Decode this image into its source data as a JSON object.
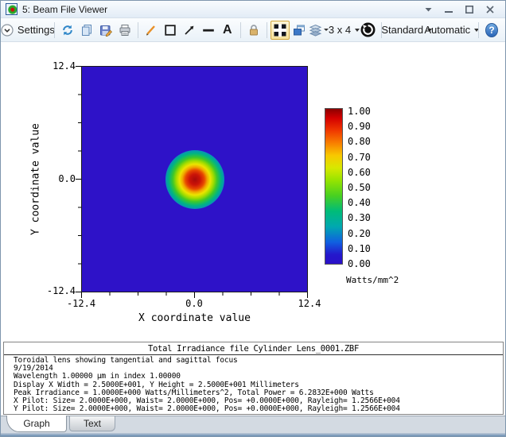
{
  "titlebar": {
    "title": "5: Beam File Viewer"
  },
  "toolbar": {
    "settings_label": "Settings",
    "text_tool_label": "A",
    "grid_label": "3 x 4",
    "standard_label": "Standard",
    "automatic_label": "Automatic",
    "help_glyph": "?"
  },
  "plot": {
    "y_axis_label": "Y coordinate value",
    "x_axis_label": "X coordinate value",
    "y_ticks": [
      "12.4",
      "0.0",
      "-12.4"
    ],
    "x_ticks": [
      "-12.4",
      "0.0",
      "12.4"
    ],
    "colorbar": {
      "labels": [
        "1.00",
        "0.90",
        "0.80",
        "0.70",
        "0.60",
        "0.50",
        "0.40",
        "0.30",
        "0.20",
        "0.10",
        "0.00"
      ],
      "unit": "Watts/mm^2"
    },
    "background_color": "#2E12C8"
  },
  "text_panel": {
    "title": "Total Irradiance file Cylinder Lens_0001.ZBF",
    "lines": [
      "Toroidal lens showing tangential and sagittal focus",
      "9/19/2014",
      "Wavelength 1.00000 µm in index 1.00000",
      "Display X Width = 2.5000E+001, Y Height = 2.5000E+001 Millimeters",
      "Peak Irradiance = 1.0000E+000 Watts/Millimeters^2, Total Power = 6.2832E+000 Watts",
      "X Pilot: Size= 2.0000E+000, Waist= 2.0000E+000, Pos= +0.0000E+000, Rayleigh= 1.2566E+004",
      "Y Pilot: Size= 2.0000E+000, Waist= 2.0000E+000, Pos= +0.0000E+000, Rayleigh= 1.2566E+004"
    ]
  },
  "tabs": [
    {
      "label": "Graph",
      "active": true
    },
    {
      "label": "Text",
      "active": false
    }
  ],
  "chart_data": {
    "type": "heatmap",
    "title": "Total Irradiance file Cylinder Lens_0001.ZBF",
    "xlabel": "X coordinate value",
    "ylabel": "Y coordinate value",
    "xlim": [
      -12.4,
      12.4
    ],
    "ylim": [
      -12.4,
      12.4
    ],
    "colorbar_range": [
      0.0,
      1.0
    ],
    "colorbar_tick_step": 0.1,
    "colorbar_unit": "Watts/mm^2",
    "colormap": "jet",
    "description": "Gaussian beam spot centered at (0,0) with peak irradiance 1.0 Watts/mm^2 on a uniform 0.0 (blue) background"
  }
}
